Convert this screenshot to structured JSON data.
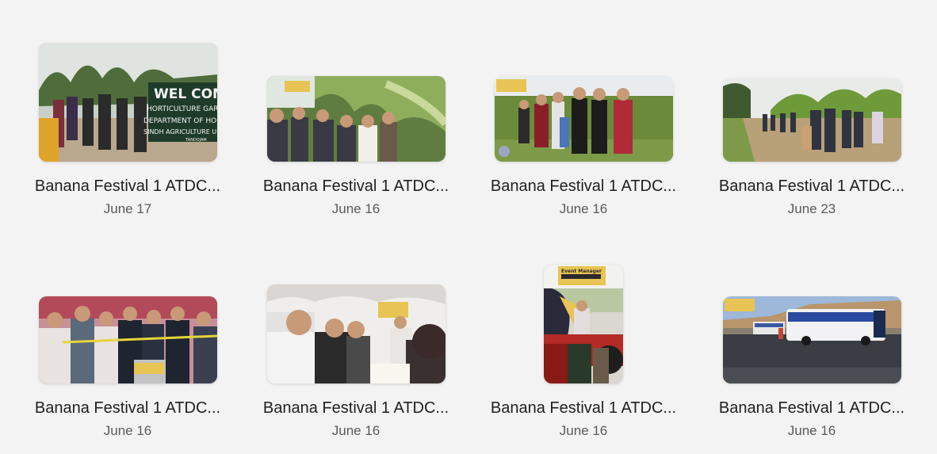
{
  "gallery": {
    "items": [
      {
        "title": "Banana Festival 1 ATDC...",
        "date": "June 17",
        "image": "welcome-sign-crowd-photo",
        "sign_text": [
          "WEL COME",
          "HORTICULTURE GAR",
          "DEPARTMENT OF HORTICUL",
          "SINDH AGRICULTURE UNIVE",
          "TANDOJAM"
        ]
      },
      {
        "title": "Banana Festival 1 ATDC...",
        "date": "June 16",
        "image": "group-in-banana-plantation-photo"
      },
      {
        "title": "Banana Festival 1 ATDC...",
        "date": "June 16",
        "image": "group-standing-in-field-photo"
      },
      {
        "title": "Banana Festival 1 ATDC...",
        "date": "June 23",
        "image": "path-beside-banana-trees-photo"
      },
      {
        "title": "Banana Festival 1 ATDC...",
        "date": "June 16",
        "image": "ribbon-cutting-ceremony-photo"
      },
      {
        "title": "Banana Festival 1 ATDC...",
        "date": "June 16",
        "image": "men-under-tent-photo"
      },
      {
        "title": "Banana Festival 1 ATDC...",
        "date": "June 16",
        "image": "tractor-event-portrait-photo",
        "banner_text": "Event Manager"
      },
      {
        "title": "Banana Festival 1 ATDC...",
        "date": "June 16",
        "image": "buses-on-road-photo"
      }
    ]
  },
  "colors": {
    "background": "#f3f3f3",
    "title": "#1f1f1f",
    "date": "#5a5a5a"
  }
}
